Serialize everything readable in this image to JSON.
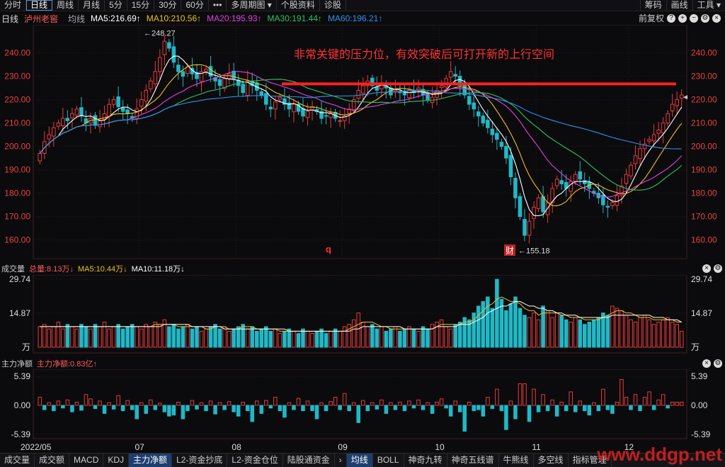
{
  "toolbar": {
    "items": [
      "分时",
      "日线",
      "周线",
      "月线",
      "5分",
      "15分",
      "30分",
      "60分",
      "•••",
      "多周期图 ▾",
      "个股资料",
      "诊股"
    ],
    "active_index": 1,
    "right_items": [
      "筹码",
      "画线",
      "工具 ▾"
    ]
  },
  "legend": {
    "period": "日线",
    "name": "泸州老窖",
    "ma_label": "均线",
    "ma5": "MA5:216.69↑",
    "ma10": "MA10:210.56↑",
    "ma20": "MA20:195.93↑",
    "ma30": "MA30:191.44↑",
    "ma60": "MA60:196.21↑",
    "adj": "前复权"
  },
  "colors": {
    "up": "#e83a3a",
    "down": "#21b8c6",
    "ma5": "#ffffff",
    "ma10": "#f0c020",
    "ma20": "#e040e0",
    "ma30": "#30c060",
    "ma60": "#3090f0",
    "axis_text": "#e84040",
    "grid": "#2a1818"
  },
  "volume_header": {
    "label": "成交量",
    "total": "总量:8.13万↓",
    "ma5": "MA5:10.44万↓",
    "ma10": "MA10:11.18万↓",
    "unit": "万"
  },
  "flow_header": {
    "label": "主力净额",
    "value": "主力净额:0.83亿↑"
  },
  "annotation": {
    "text": "非常关键的压力位，有效突破后可打开新的上行空间",
    "high_label": "248.27",
    "low_label": "155.18",
    "marker_q": "q",
    "marker_cai": "财"
  },
  "bottom_tabs": [
    "成交量",
    "成交额",
    "MACD",
    "KDJ",
    "主力净额",
    "L2-资金抄底",
    "L2-资金仓位",
    "陆股通资金",
    "均线",
    "BOLL",
    "神奇九转",
    "神奇五线谱",
    "牛熊线",
    "多空线",
    "指标管理"
  ],
  "bottom_active": [
    4,
    8
  ],
  "watermark": "www.ddgp.net",
  "chart_data": [
    {
      "type": "candlestick",
      "title": "泸州老窖 日线",
      "x": [
        "2022/05",
        "07",
        "08",
        "09",
        "10",
        "11",
        "12"
      ],
      "y_ticks": [
        160,
        170,
        180,
        190,
        200,
        210,
        220,
        230,
        240
      ],
      "ylim": [
        152,
        252
      ],
      "resistance": 234,
      "high": 248.27,
      "low": 155.18,
      "close": [
        197,
        202,
        205,
        208,
        210,
        212,
        211,
        214,
        216,
        213,
        210,
        212,
        209,
        211,
        214,
        218,
        220,
        217,
        215,
        214,
        212,
        216,
        220,
        224,
        228,
        232,
        238,
        245,
        242,
        236,
        232,
        230,
        234,
        231,
        229,
        232,
        233,
        230,
        228,
        226,
        229,
        231,
        229,
        226,
        223,
        228,
        226,
        224,
        222,
        218,
        216,
        219,
        221,
        218,
        216,
        218,
        215,
        213,
        215,
        217,
        215,
        212,
        213,
        214,
        212,
        211,
        213,
        216,
        220,
        224,
        226,
        228,
        226,
        224,
        227,
        225,
        222,
        224,
        223,
        222,
        224,
        223,
        225,
        222,
        220,
        221,
        224,
        226,
        229,
        232,
        230,
        226,
        222,
        218,
        216,
        213,
        210,
        208,
        205,
        203,
        200,
        195,
        187,
        178,
        170,
        162,
        168,
        174,
        178,
        172,
        176,
        182,
        186,
        184,
        182,
        185,
        188,
        186,
        184,
        182,
        180,
        178,
        175,
        174,
        176,
        179,
        183,
        188,
        192,
        196,
        199,
        201,
        203,
        205,
        207,
        210,
        214,
        218,
        220,
        222
      ]
    },
    {
      "type": "bar",
      "title": "成交量",
      "y_ticks": [
        14.87,
        29.74
      ],
      "ylim": [
        0,
        29.74
      ],
      "values": [
        9,
        10,
        8,
        9,
        11,
        8,
        10,
        9,
        8,
        10,
        9,
        8,
        10,
        9,
        11,
        8,
        9,
        10,
        8,
        9,
        10,
        9,
        8,
        10,
        9,
        11,
        10,
        12,
        9,
        10,
        8,
        9,
        10,
        8,
        9,
        7,
        8,
        9,
        10,
        8,
        9,
        7,
        8,
        9,
        10,
        8,
        9,
        7,
        8,
        9,
        7,
        8,
        6,
        7,
        8,
        7,
        6,
        8,
        7,
        6,
        7,
        8,
        6,
        7,
        8,
        7,
        9,
        10,
        12,
        15,
        11,
        9,
        10,
        8,
        9,
        7,
        8,
        9,
        7,
        8,
        9,
        8,
        7,
        9,
        8,
        10,
        11,
        12,
        9,
        8,
        10,
        11,
        13,
        12,
        15,
        18,
        20,
        22,
        17,
        29.7,
        21,
        16,
        19,
        22,
        17,
        14,
        13,
        15,
        12,
        18,
        16,
        13,
        15,
        14,
        12,
        11,
        13,
        12,
        10,
        11,
        12,
        13,
        15,
        14,
        18,
        17,
        16,
        14,
        12,
        11,
        13,
        14,
        12,
        10,
        11,
        12,
        13,
        11,
        10,
        7
      ],
      "ma5": [
        9,
        9,
        9,
        9,
        9,
        9,
        9,
        9,
        9,
        9,
        9,
        9,
        9,
        9,
        9,
        9,
        9,
        9,
        9,
        9,
        9,
        9,
        9,
        9,
        9,
        10,
        10,
        10,
        10,
        10,
        9,
        9,
        9,
        9,
        9,
        9,
        8,
        8,
        9,
        9,
        9,
        8,
        8,
        8,
        9,
        9,
        9,
        8,
        8,
        8,
        8,
        8,
        7,
        7,
        7,
        7,
        7,
        7,
        7,
        7,
        7,
        7,
        7,
        7,
        7,
        7,
        7,
        8,
        9,
        10,
        11,
        11,
        11,
        10,
        9,
        9,
        8,
        8,
        8,
        8,
        8,
        8,
        8,
        8,
        8,
        8,
        9,
        10,
        10,
        10,
        10,
        10,
        11,
        11,
        12,
        14,
        16,
        18,
        19,
        21,
        22,
        21,
        20,
        20,
        19,
        17,
        16,
        16,
        14,
        15,
        15,
        15,
        15,
        14,
        14,
        13,
        13,
        13,
        12,
        12,
        12,
        12,
        13,
        14,
        15,
        16,
        16,
        15,
        15,
        14,
        13,
        13,
        13,
        12,
        12,
        12,
        12,
        12,
        11,
        11
      ],
      "ma10": [
        9,
        9,
        9,
        9,
        9,
        9,
        9,
        9,
        9,
        9,
        9,
        9,
        9,
        9,
        9,
        9,
        9,
        9,
        9,
        9,
        9,
        9,
        9,
        9,
        9,
        9,
        9,
        10,
        10,
        10,
        10,
        10,
        10,
        9,
        9,
        9,
        9,
        9,
        9,
        9,
        8,
        8,
        8,
        8,
        8,
        8,
        8,
        8,
        8,
        8,
        8,
        8,
        8,
        8,
        7,
        7,
        7,
        7,
        7,
        7,
        7,
        7,
        7,
        7,
        7,
        7,
        7,
        7,
        8,
        8,
        9,
        9,
        9,
        9,
        9,
        9,
        9,
        9,
        9,
        8,
        8,
        8,
        8,
        8,
        8,
        8,
        9,
        9,
        9,
        9,
        9,
        10,
        10,
        10,
        11,
        12,
        13,
        15,
        16,
        17,
        18,
        18,
        19,
        20,
        20,
        19,
        18,
        18,
        17,
        17,
        16,
        16,
        15,
        15,
        14,
        14,
        14,
        13,
        13,
        13,
        13,
        13,
        13,
        13,
        14,
        14,
        14,
        14,
        14,
        14,
        14,
        14,
        14,
        13,
        13,
        13,
        12,
        12,
        12,
        11
      ]
    },
    {
      "type": "bar",
      "title": "主力净额",
      "y_ticks": [
        -5.39,
        0.0,
        5.39
      ],
      "ylim": [
        -5.39,
        5.39
      ],
      "values": [
        1.5,
        -0.8,
        0.5,
        -1.0,
        0.8,
        -0.5,
        1.0,
        -1.2,
        0.6,
        -0.9,
        2.0,
        1.2,
        -0.6,
        0.8,
        -1.5,
        0.5,
        -0.7,
        1.8,
        -1.0,
        0.9,
        -0.8,
        -2.5,
        0.5,
        -1.5,
        1.0,
        -0.8,
        0.4,
        -1.2,
        -2.0,
        -1.8,
        0.6,
        -2.5,
        -1.0,
        0.9,
        -0.7,
        0.5,
        -1.0,
        0.8,
        -1.6,
        0.5,
        -0.8,
        0.7,
        -1.2,
        -2.0,
        0.6,
        -1.0,
        -3.0,
        0.8,
        -1.5,
        0.9,
        -0.5,
        1.5,
        -1.0,
        -2.2,
        0.5,
        -0.8,
        1.3,
        -1.0,
        0.8,
        -1.0,
        -2.5,
        0.5,
        -1.0,
        0.7,
        1.5,
        -0.8,
        2.2,
        -1.0,
        0.5,
        -3.2,
        0.9,
        -1.0,
        0.5,
        -0.7,
        1.0,
        -1.5,
        0.5,
        -0.8,
        0.6,
        -1.0,
        0.8,
        -0.5,
        1.0,
        -0.8,
        0.5,
        -1.5,
        0.6,
        1.2,
        -0.5,
        -2.0,
        0.8,
        -1.2,
        -4.8,
        0.6,
        -1.0,
        -0.8,
        -2.0,
        1.5,
        -0.6,
        3.0,
        -1.0,
        -4.5,
        0.8,
        -2.5,
        4.0,
        4.0,
        -3.0,
        3.0,
        -1.2,
        2.0,
        -1.0,
        1.0,
        -2.0,
        0.6,
        -1.0,
        2.5,
        -1.2,
        0.8,
        -1.0,
        -1.8,
        0.5,
        -1.0,
        3.0,
        -0.8,
        -1.5,
        0.6,
        4.8,
        1.5,
        -0.8,
        2.0,
        -1.0,
        1.5,
        2.5,
        -0.8,
        1.0,
        2.0,
        -0.5,
        0.6,
        0.6,
        0.6
      ]
    }
  ]
}
